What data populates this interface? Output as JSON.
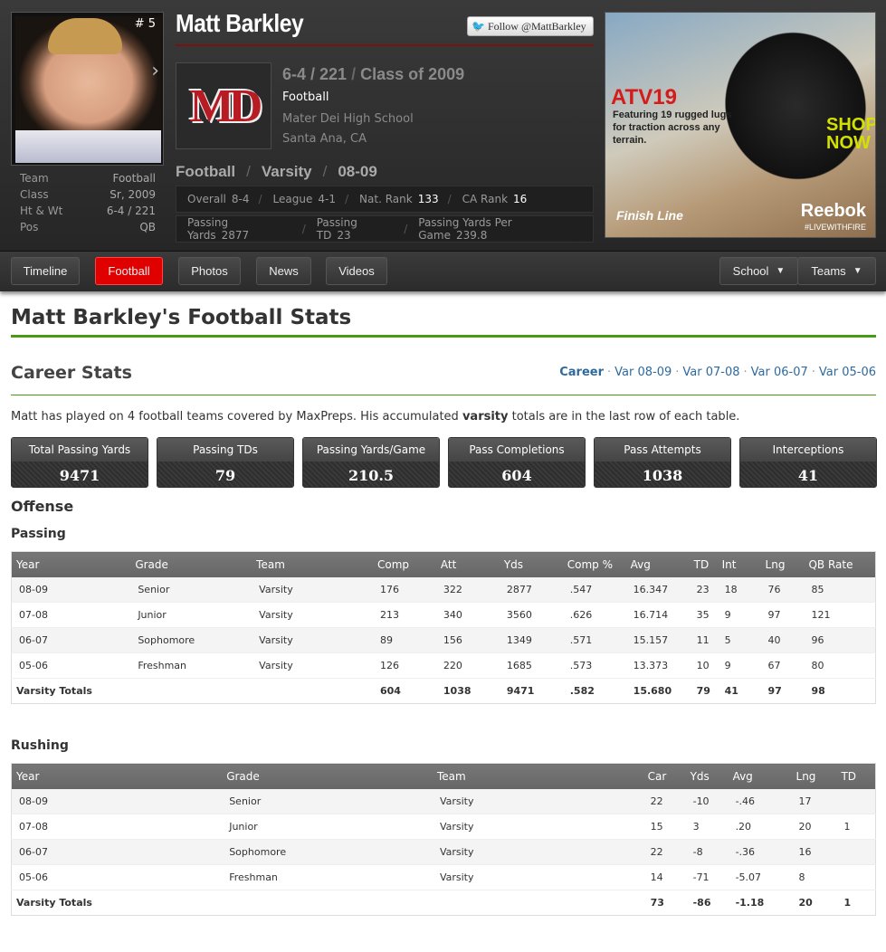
{
  "player": {
    "name": "Matt Barkley",
    "jersey": "# 5",
    "follow_label": "Follow @MattBarkley",
    "height_weight": "6-4 / 221",
    "class_of": "Class of 2009",
    "sport": "Football",
    "school": "Mater Dei High School",
    "city": "Santa Ana, CA",
    "logo_text": "MD"
  },
  "side": [
    {
      "label": "Team",
      "value": "Football"
    },
    {
      "label": "Class",
      "value": "Sr, 2009"
    },
    {
      "label": "Ht & Wt",
      "value": "6-4 / 221"
    },
    {
      "label": "Pos",
      "value": "QB"
    }
  ],
  "crumbs": {
    "sport": "Football",
    "level": "Varsity",
    "season": "08-09"
  },
  "statbar1": [
    {
      "label": "Overall",
      "value": "8-4",
      "bright": false
    },
    {
      "label": "League",
      "value": "4-1",
      "bright": false
    },
    {
      "label": "Nat. Rank",
      "value": "133",
      "bright": true
    },
    {
      "label": "CA Rank",
      "value": "16",
      "bright": true
    }
  ],
  "statbar2": [
    {
      "label": "Passing Yards",
      "value": "2877"
    },
    {
      "label": "Passing TD",
      "value": "23"
    },
    {
      "label": "Passing Yards Per Game",
      "value": "239.8"
    }
  ],
  "ad": {
    "headline": "ATV19",
    "text": "Featuring 19 rugged lugs for traction across any terrain.",
    "shop": "SHOP NOW",
    "finish": "Finish Line",
    "brand": "Reebok",
    "tag": "#LIVEWITHFIRE"
  },
  "nav": {
    "tabs": [
      "Timeline",
      "Football",
      "Photos",
      "News",
      "Videos"
    ],
    "active": "Football",
    "school": "School",
    "teams": "Teams"
  },
  "page": {
    "title": "Matt Barkley's Football Stats",
    "career_heading": "Career Stats",
    "career_links": [
      "Career",
      "Var 08-09",
      "Var 07-08",
      "Var 06-07",
      "Var 05-06"
    ],
    "intro_pre": "Matt has played on 4 football teams covered by MaxPreps. His accumulated ",
    "intro_bold": "varsity",
    "intro_post": " totals are in the last row of each table.",
    "offense": "Offense",
    "passing": "Passing",
    "rushing": "Rushing"
  },
  "tiles": [
    {
      "label": "Total Passing Yards",
      "value": "9471"
    },
    {
      "label": "Passing TDs",
      "value": "79"
    },
    {
      "label": "Passing Yards/Game",
      "value": "210.5"
    },
    {
      "label": "Pass Completions",
      "value": "604"
    },
    {
      "label": "Pass Attempts",
      "value": "1038"
    },
    {
      "label": "Interceptions",
      "value": "41"
    }
  ],
  "passing": {
    "headers": [
      "Year",
      "Grade",
      "Team",
      "Comp",
      "Att",
      "Yds",
      "Comp %",
      "Avg",
      "TD",
      "Int",
      "Lng",
      "QB Rate"
    ],
    "rows": [
      [
        "08-09",
        "Senior",
        "Varsity",
        "176",
        "322",
        "2877",
        ".547",
        "16.347",
        "23",
        "18",
        "76",
        "85"
      ],
      [
        "07-08",
        "Junior",
        "Varsity",
        "213",
        "340",
        "3560",
        ".626",
        "16.714",
        "35",
        "9",
        "97",
        "121"
      ],
      [
        "06-07",
        "Sophomore",
        "Varsity",
        "89",
        "156",
        "1349",
        ".571",
        "15.157",
        "11",
        "5",
        "40",
        "96"
      ],
      [
        "05-06",
        "Freshman",
        "Varsity",
        "126",
        "220",
        "1685",
        ".573",
        "13.373",
        "10",
        "9",
        "67",
        "80"
      ]
    ],
    "totals": [
      "Varsity Totals",
      "",
      "",
      "604",
      "1038",
      "9471",
      ".582",
      "15.680",
      "79",
      "41",
      "97",
      "98"
    ]
  },
  "rushing": {
    "headers": [
      "Year",
      "Grade",
      "Team",
      "Car",
      "Yds",
      "Avg",
      "Lng",
      "TD"
    ],
    "rows": [
      [
        "08-09",
        "Senior",
        "Varsity",
        "22",
        "-10",
        "-.46",
        "17",
        ""
      ],
      [
        "07-08",
        "Junior",
        "Varsity",
        "15",
        "3",
        ".20",
        "20",
        "1"
      ],
      [
        "06-07",
        "Sophomore",
        "Varsity",
        "22",
        "-8",
        "-.36",
        "16",
        ""
      ],
      [
        "05-06",
        "Freshman",
        "Varsity",
        "14",
        "-71",
        "-5.07",
        "8",
        ""
      ]
    ],
    "totals": [
      "Varsity Totals",
      "",
      "",
      "73",
      "-86",
      "-1.18",
      "20",
      "1"
    ]
  }
}
